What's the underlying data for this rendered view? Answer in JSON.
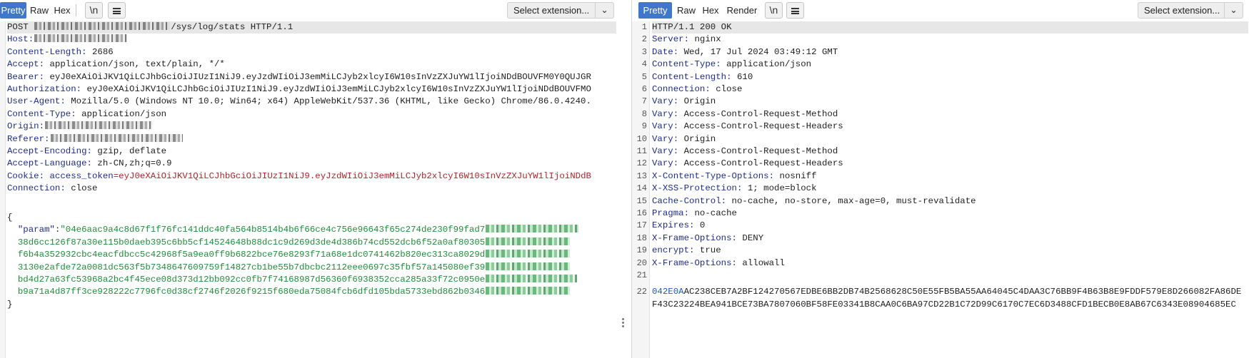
{
  "request": {
    "tabs": [
      {
        "label": "Pretty",
        "active": true
      },
      {
        "label": "Raw",
        "active": false
      },
      {
        "label": "Hex",
        "active": false
      }
    ],
    "newline_label": "\\n",
    "select_label": "Select extension...",
    "lines": [
      {
        "kind": "request-line",
        "prefix": "POST ",
        "suffix": "/sys/log/stats HTTP/1.1"
      },
      {
        "kind": "masked-header",
        "key": "Host:"
      },
      {
        "kind": "header",
        "key": "Content-Length:",
        "value": " 2686"
      },
      {
        "kind": "header",
        "key": "Accept:",
        "value": " application/json, text/plain, */*"
      },
      {
        "kind": "header",
        "key": "Bearer:",
        "value": " eyJ0eXAiOiJKV1QiLCJhbGciOiJIUzI1NiJ9.eyJzdWIiOiJ3emMiLCJyb2xlcyI6W10sInVzZXJuYW1lIjoiNDdBOUVFM0Y0QUJGR"
      },
      {
        "kind": "header",
        "key": "Authorization:",
        "value": " eyJ0eXAiOiJKV1QiLCJhbGciOiJIUzI1NiJ9.eyJzdWIiOiJ3emMiLCJyb2xlcyI6W10sInVzZXJuYW1lIjoiNDdBOUVFMO"
      },
      {
        "kind": "header",
        "key": "User-Agent:",
        "value": " Mozilla/5.0 (Windows NT 10.0; Win64; x64) AppleWebKit/537.36 (KHTML, like Gecko) Chrome/86.0.4240."
      },
      {
        "kind": "header",
        "key": "Content-Type:",
        "value": " application/json"
      },
      {
        "kind": "masked-header",
        "key": "Origin:"
      },
      {
        "kind": "masked-header",
        "key": "Referer:"
      },
      {
        "kind": "header",
        "key": "Accept-Encoding:",
        "value": " gzip, deflate"
      },
      {
        "kind": "header",
        "key": "Accept-Language:",
        "value": " zh-CN,zh;q=0.9"
      },
      {
        "kind": "cookie",
        "key": "Cookie:",
        "name": " access_token",
        "value": "=eyJ0eXAiOiJKV1QiLCJhbGciOiJIUzI1NiJ9.eyJzdWIiOiJ3emMiLCJyb2xlcyI6W10sInVzZXJuYW1lIjoiNDdB"
      },
      {
        "kind": "header",
        "key": "Connection:",
        "value": " close"
      },
      {
        "kind": "blank"
      },
      {
        "kind": "plain",
        "text": "{"
      },
      {
        "kind": "json-first",
        "key": "  \"param\"",
        "sep": ":",
        "value": "\"04e6aac9a4c8d67f1f76fc141ddc40fa564b8514b4b6f66ce4c756e96643f65c274de230f99fad7"
      },
      {
        "kind": "json-cont",
        "value": "  38d6cc126f87a30e115b0daeb395c6bb5cf14524648b88dc1c9d269d3de4d386b74cd552dcb6f52a0af80305"
      },
      {
        "kind": "json-cont",
        "value": "  f6b4a352932cbc4eacfdbcc5c42968f5a9ea0ff9b6822bce76e8293f71a68e1dc0741462b820ec313ca8029d"
      },
      {
        "kind": "json-cont",
        "value": "  3130e2afde72a0081dc563f5b7348647609759f14827cb1be55b7dbcbc2112eee0697c35fbf57a145080ef39"
      },
      {
        "kind": "json-cont",
        "value": "  bd4d27a63fc53968a2bc4f45ece08d373d12bb092cc0fb7f74168987d56360f6938352cca285a33f72c0950e"
      },
      {
        "kind": "json-cont",
        "value": "  b9a71a4d87ff3ce928222c7796fc0d38cf2746f2026f9215f680eda75084fcb6dfd105bda5733ebd862b0346"
      },
      {
        "kind": "plain",
        "text": "}"
      }
    ]
  },
  "response": {
    "tabs": [
      {
        "label": "Pretty",
        "active": true
      },
      {
        "label": "Raw",
        "active": false
      },
      {
        "label": "Hex",
        "active": false
      },
      {
        "label": "Render",
        "active": false
      }
    ],
    "newline_label": "\\n",
    "select_label": "Select extension...",
    "lines": [
      {
        "n": "1",
        "kind": "plain",
        "text": "HTTP/1.1 200 OK"
      },
      {
        "n": "2",
        "kind": "header",
        "key": "Server:",
        "value": " nginx"
      },
      {
        "n": "3",
        "kind": "header",
        "key": "Date:",
        "value": " Wed, 17 Jul 2024 03:49:12 GMT"
      },
      {
        "n": "4",
        "kind": "header",
        "key": "Content-Type:",
        "value": " application/json"
      },
      {
        "n": "5",
        "kind": "header",
        "key": "Content-Length:",
        "value": " 610"
      },
      {
        "n": "6",
        "kind": "header",
        "key": "Connection:",
        "value": " close"
      },
      {
        "n": "7",
        "kind": "header",
        "key": "Vary:",
        "value": " Origin"
      },
      {
        "n": "8",
        "kind": "header",
        "key": "Vary:",
        "value": " Access-Control-Request-Method"
      },
      {
        "n": "9",
        "kind": "header",
        "key": "Vary:",
        "value": " Access-Control-Request-Headers"
      },
      {
        "n": "10",
        "kind": "header",
        "key": "Vary:",
        "value": " Origin"
      },
      {
        "n": "11",
        "kind": "header",
        "key": "Vary:",
        "value": " Access-Control-Request-Method"
      },
      {
        "n": "12",
        "kind": "header",
        "key": "Vary:",
        "value": " Access-Control-Request-Headers"
      },
      {
        "n": "13",
        "kind": "header",
        "key": "X-Content-Type-Options:",
        "value": " nosniff"
      },
      {
        "n": "14",
        "kind": "header",
        "key": "X-XSS-Protection:",
        "value": " 1; mode=block"
      },
      {
        "n": "15",
        "kind": "header",
        "key": "Cache-Control:",
        "value": " no-cache, no-store, max-age=0, must-revalidate"
      },
      {
        "n": "16",
        "kind": "header",
        "key": "Pragma:",
        "value": " no-cache"
      },
      {
        "n": "17",
        "kind": "header",
        "key": "Expires:",
        "value": " 0"
      },
      {
        "n": "18",
        "kind": "header",
        "key": "X-Frame-Options:",
        "value": " DENY"
      },
      {
        "n": "19",
        "kind": "header",
        "key": "encrypt:",
        "value": " true"
      },
      {
        "n": "20",
        "kind": "header",
        "key": "X-Frame-Options:",
        "value": " allowall"
      },
      {
        "n": "21",
        "kind": "blank"
      },
      {
        "n": "22",
        "kind": "hex",
        "key": "042E0A",
        "value": "AC238CEB7A2BF124270567EDBE6BB2DB74B2568628C50E55FB5BA55AA64045C4DAA3C76BB9F4B63B8E9FDDF579E8D266082FA86DE"
      },
      {
        "n": "",
        "kind": "hex-cont",
        "value": "F43C23224BEA941BCE73BA7807060BF58FE03341B8CAA0C6BA97CD22B1C72D99C6170C7EC6D3488CFD1BECB0E8AB67C6343E08904685EC"
      }
    ]
  }
}
